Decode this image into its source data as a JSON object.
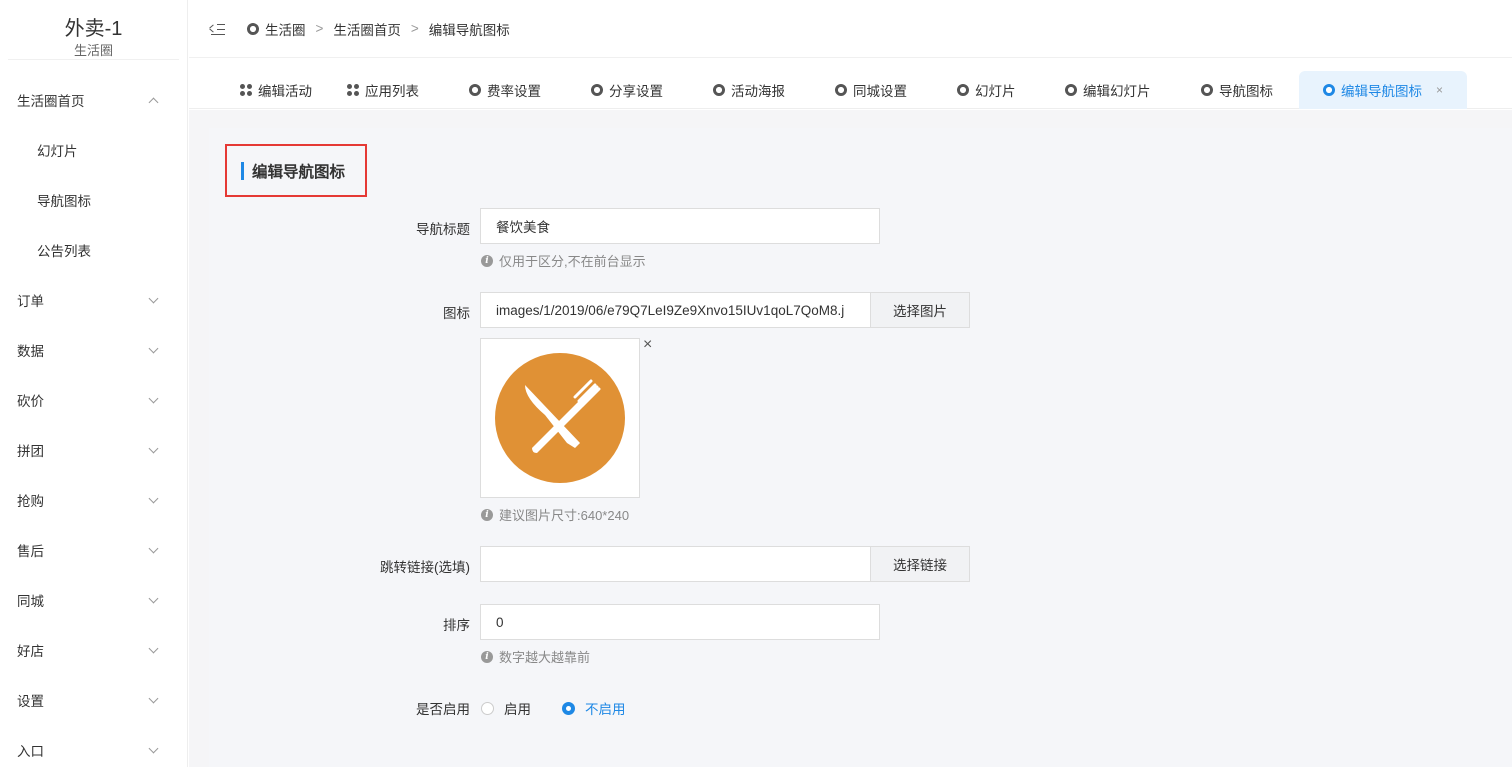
{
  "sidebar": {
    "brand_title": "外卖-1",
    "brand_sub": "生活圈",
    "items": [
      {
        "label": "生活圈首页"
      },
      {
        "label": "幻灯片"
      },
      {
        "label": "导航图标"
      },
      {
        "label": "公告列表"
      },
      {
        "label": "订单"
      },
      {
        "label": "数据"
      },
      {
        "label": "砍价"
      },
      {
        "label": "拼团"
      },
      {
        "label": "抢购"
      },
      {
        "label": "售后"
      },
      {
        "label": "同城"
      },
      {
        "label": "好店"
      },
      {
        "label": "设置"
      },
      {
        "label": "入口"
      }
    ]
  },
  "breadcrumb": [
    "生活圈",
    "生活圈首页",
    "编辑导航图标"
  ],
  "breadcrumb_sep": ">",
  "tabs": [
    {
      "label": "编辑活动"
    },
    {
      "label": "应用列表"
    },
    {
      "label": "费率设置"
    },
    {
      "label": "分享设置"
    },
    {
      "label": "活动海报"
    },
    {
      "label": "同城设置"
    },
    {
      "label": "幻灯片"
    },
    {
      "label": "编辑幻灯片"
    },
    {
      "label": "导航图标"
    },
    {
      "label": "编辑导航图标"
    }
  ],
  "tab_close": "×",
  "form": {
    "section_title": "编辑导航图标",
    "nav_title_label": "导航标题",
    "nav_title_value": "餐饮美食",
    "nav_title_hint": "仅用于区分,不在前台显示",
    "icon_label": "图标",
    "icon_value": "images/1/2019/06/e79Q7LeI9Ze9Xnvo15IUv1qoL7QoM8.j",
    "icon_button": "选择图片",
    "icon_remove": "×",
    "icon_hint": "建议图片尺寸:640*240",
    "link_label": "跳转链接(选填)",
    "link_value": "",
    "link_button": "选择链接",
    "sort_label": "排序",
    "sort_value": "0",
    "sort_hint": "数字越大越靠前",
    "enable_label": "是否启用",
    "enable_options": [
      {
        "label": "启用"
      },
      {
        "label": "不启用"
      }
    ],
    "enable_selected": "不启用"
  },
  "colors": {
    "accent": "#1e88e5",
    "icon_bg": "#e09135",
    "highlight_border": "#e53935"
  },
  "info_glyph": "i"
}
